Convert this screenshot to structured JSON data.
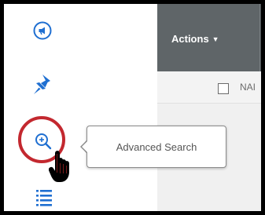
{
  "grid": {
    "actions_label": "Actions",
    "actions_caret": "▼",
    "name_column_partial": "NAI"
  },
  "tooltip": {
    "text": "Advanced Search"
  },
  "nav": {
    "items": [
      {
        "icon": "megaphone-icon"
      },
      {
        "icon": "pin-icon"
      },
      {
        "icon": "zoom-in-icon"
      },
      {
        "icon": "list-icon"
      }
    ]
  },
  "colors": {
    "accent_blue": "#1f6fd1",
    "header_gray": "#5f6568",
    "highlight_red": "#c3282f"
  }
}
